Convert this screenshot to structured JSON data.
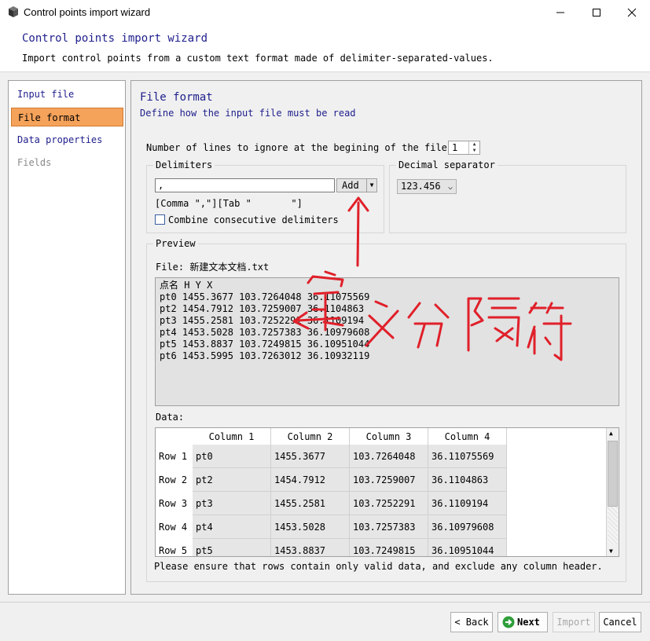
{
  "window": {
    "title": "Control points import wizard"
  },
  "header": {
    "title": "Control points import wizard",
    "subtitle": "Import control points from a custom text format made of delimiter-separated-values."
  },
  "steps": [
    {
      "label": "Input file",
      "state": "normal"
    },
    {
      "label": "File format",
      "state": "active"
    },
    {
      "label": "Data properties",
      "state": "normal"
    },
    {
      "label": "Fields",
      "state": "disabled"
    }
  ],
  "main": {
    "title": "File format",
    "subtitle": "Define how the input file must be read",
    "lines_to_ignore_label": "Number of lines to ignore at the begining of the file:",
    "lines_to_ignore_value": "1",
    "delimiters": {
      "group_label": "Delimiters",
      "input_value": ",",
      "add_label": "Add",
      "list_text": "[Comma \",\"][Tab \"       \"]",
      "combine_label": "Combine consecutive delimiters",
      "combine_checked": false
    },
    "decimal": {
      "group_label": "Decimal separator",
      "selected": "123.456"
    },
    "preview": {
      "group_label": "Preview",
      "file_label": "File: 新建文本文档.txt",
      "lines": [
        "点名 H Y X",
        "pt0 1455.3677 103.7264048 36.11075569",
        "pt2 1454.7912 103.7259007 36.1104863",
        "pt3 1455.2581 103.7252291 36.1109194",
        "pt4 1453.5028 103.7257383 36.10979608",
        "pt5 1453.8837 103.7249815 36.10951044",
        "pt6 1453.5995 103.7263012 36.10932119"
      ],
      "data_label": "Data:",
      "columns": [
        "Column 1",
        "Column 2",
        "Column 3",
        "Column 4"
      ],
      "rows": [
        {
          "header": "Row 1",
          "cells": [
            "pt0",
            "1455.3677",
            "103.7264048",
            "36.11075569"
          ]
        },
        {
          "header": "Row 2",
          "cells": [
            "pt2",
            "1454.7912",
            "103.7259007",
            "36.1104863"
          ]
        },
        {
          "header": "Row 3",
          "cells": [
            "pt3",
            "1455.2581",
            "103.7252291",
            "36.1109194"
          ]
        },
        {
          "header": "Row 4",
          "cells": [
            "pt4",
            "1453.5028",
            "103.7257383",
            "36.10979608"
          ]
        },
        {
          "header": "Row 5",
          "cells": [
            "pt5",
            "1453.8837",
            "103.7249815",
            "36.10951044"
          ]
        }
      ],
      "note": "Please ensure that rows contain only valid data, and exclude any column header."
    }
  },
  "footer": {
    "back_label": "< Back",
    "next_label": "Next",
    "import_label": "Import",
    "cancel_label": "Cancel"
  },
  "annotation": {
    "text": "定义分隔符",
    "color": "#e0202a"
  }
}
